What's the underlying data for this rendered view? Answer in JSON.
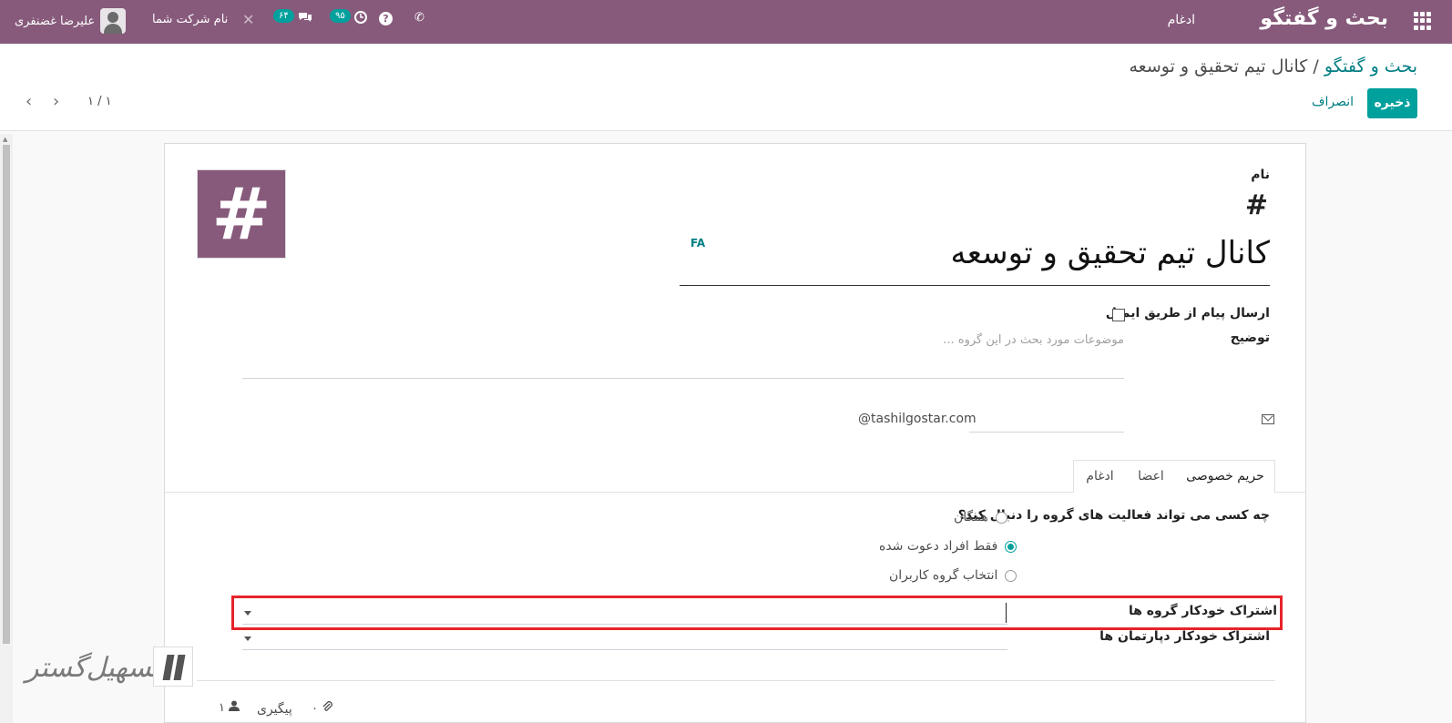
{
  "navbar": {
    "brand": "بحث و گفتگو",
    "menu_merge": "ادغام",
    "user_name": "علیرضا غضنفری",
    "company": "نام شرکت شما",
    "chat_badge": "۶۴",
    "activity_badge": "۹۵",
    "close_icon": "✕",
    "help_icon": "?",
    "phone_icon": "✆",
    "colors": {
      "bar": "#875a7b",
      "badge": "#00a09d"
    }
  },
  "control_panel": {
    "breadcrumb_root": "بحث و گفتگو",
    "breadcrumb_sep": " / ",
    "breadcrumb_current": "کانال تیم تحقیق و توسعه",
    "save_label": "ذخیره",
    "discard_label": "انصراف",
    "pager_value": "۱ / ۱",
    "prev_icon": "‹",
    "next_icon": "›"
  },
  "form": {
    "image_symbol": "#",
    "name_label": "نام",
    "hash_prefix": "#",
    "name_value": "کانال تیم تحقیق و توسعه",
    "lang_badge": "FA",
    "email_send_label": "ارسال پیام از طریق ایمیل",
    "description_label": "توضیح",
    "description_placeholder": "موضوعات مورد بحث در این گروه ...",
    "email_domain": "@tashilgostar.com",
    "alias_value": ""
  },
  "tabs": [
    {
      "label": "حریم خصوصی",
      "active": true
    },
    {
      "label": "اعضا",
      "active": false
    },
    {
      "label": "ادغام",
      "active": false
    }
  ],
  "privacy": {
    "question_label": "چه کسی می تواند فعالیت های گروه را دنبال کند؟",
    "options": [
      {
        "label": "همگان",
        "checked": false
      },
      {
        "label": "فقط افراد دعوت شده",
        "checked": true
      },
      {
        "label": "انتخاب گروه کاربران",
        "checked": false
      }
    ],
    "auto_groups_label": "اشتراک خودکار گروه ها",
    "auto_departments_label": "اشتراک خودکار دپارتمان ها"
  },
  "chatter": {
    "followers_count": "۱",
    "follow_label": "پیگیری",
    "attachments_count": "۰"
  },
  "watermark": {
    "text": "تسهیل‌گستر"
  }
}
